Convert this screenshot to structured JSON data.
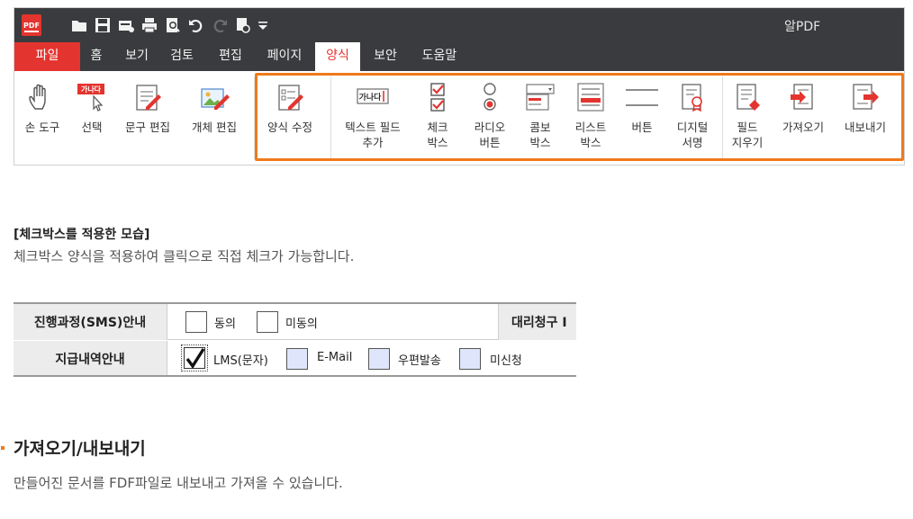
{
  "app": {
    "title": "알PDF",
    "logo_text": "PDF"
  },
  "quick_access": [
    "folder-icon",
    "save-icon",
    "scan-icon",
    "print-icon",
    "print-preview-icon",
    "undo-icon",
    "redo-icon",
    "page-settings-icon",
    "customize-dropdown-icon"
  ],
  "tabs": [
    {
      "label": "파일",
      "kind": "file"
    },
    {
      "label": "홈"
    },
    {
      "label": "보기"
    },
    {
      "label": "검토"
    },
    {
      "label": "편집"
    },
    {
      "label": "페이지"
    },
    {
      "label": "양식",
      "active": true
    },
    {
      "label": "보안"
    },
    {
      "label": "도움말"
    }
  ],
  "tools": [
    {
      "name": "hand-tool",
      "icon": "hand-icon",
      "label": "손 도구"
    },
    {
      "name": "select",
      "icon": "select-cursor-icon",
      "label": "선택",
      "icon_text": "가나다"
    },
    {
      "name": "edit-text",
      "icon": "edit-text-icon",
      "label": "문구 편집"
    },
    {
      "name": "edit-object",
      "icon": "edit-object-icon",
      "label": "개체 편집"
    },
    {
      "name": "edit-form",
      "icon": "edit-form-icon",
      "label": "양식 수정"
    },
    {
      "name": "text-field",
      "icon": "text-field-icon",
      "label": "텍스트 필드\n추가",
      "icon_text": "가나다"
    },
    {
      "name": "checkbox",
      "icon": "checkbox-icon",
      "label": "체크\n박스"
    },
    {
      "name": "radio-button",
      "icon": "radio-button-icon",
      "label": "라디오\n버튼"
    },
    {
      "name": "combo-box",
      "icon": "combo-box-icon",
      "label": "콤보\n박스"
    },
    {
      "name": "list-box",
      "icon": "list-box-icon",
      "label": "리스트\n박스"
    },
    {
      "name": "button",
      "icon": "button-icon",
      "label": "버튼"
    },
    {
      "name": "digital-signature",
      "icon": "digital-signature-icon",
      "label": "디지털\n서명"
    },
    {
      "name": "clear-fields",
      "icon": "clear-fields-icon",
      "label": "필드\n지우기"
    },
    {
      "name": "import",
      "icon": "import-icon",
      "label": "가져오기"
    },
    {
      "name": "export",
      "icon": "export-icon",
      "label": "내보내기"
    }
  ],
  "checkbox_section": {
    "heading": "[체크박스를 적용한 모습]",
    "description": "체크박스 양식을 적용하여 클릭으로 직접 체크가 가능합니다."
  },
  "form_table": {
    "row1": {
      "header": "진행과정(SMS)안내",
      "options": [
        {
          "label": "동의",
          "checked": false,
          "style": "plain"
        },
        {
          "label": "미동의",
          "checked": false,
          "style": "plain"
        }
      ],
      "right_header": "대리청구 I"
    },
    "row2": {
      "header": "지급내역안내",
      "options": [
        {
          "label": "LMS(문자)",
          "checked": true,
          "style": "checked"
        },
        {
          "label": "E-Mail",
          "checked": false,
          "style": "blue"
        },
        {
          "label": "우편발송",
          "checked": false,
          "style": "blue"
        },
        {
          "label": "미신청",
          "checked": false,
          "style": "blue"
        }
      ]
    }
  },
  "import_export_section": {
    "heading": "가져오기/내보내기",
    "description": "만들어진 문서를 FDF파일로 내보내고 가져올 수 있습니다."
  },
  "colors": {
    "accent": "#e4342f",
    "highlight": "#ef7a1a",
    "titlebar": "#3a3b3e",
    "field_blue": "#dfe6fb"
  }
}
